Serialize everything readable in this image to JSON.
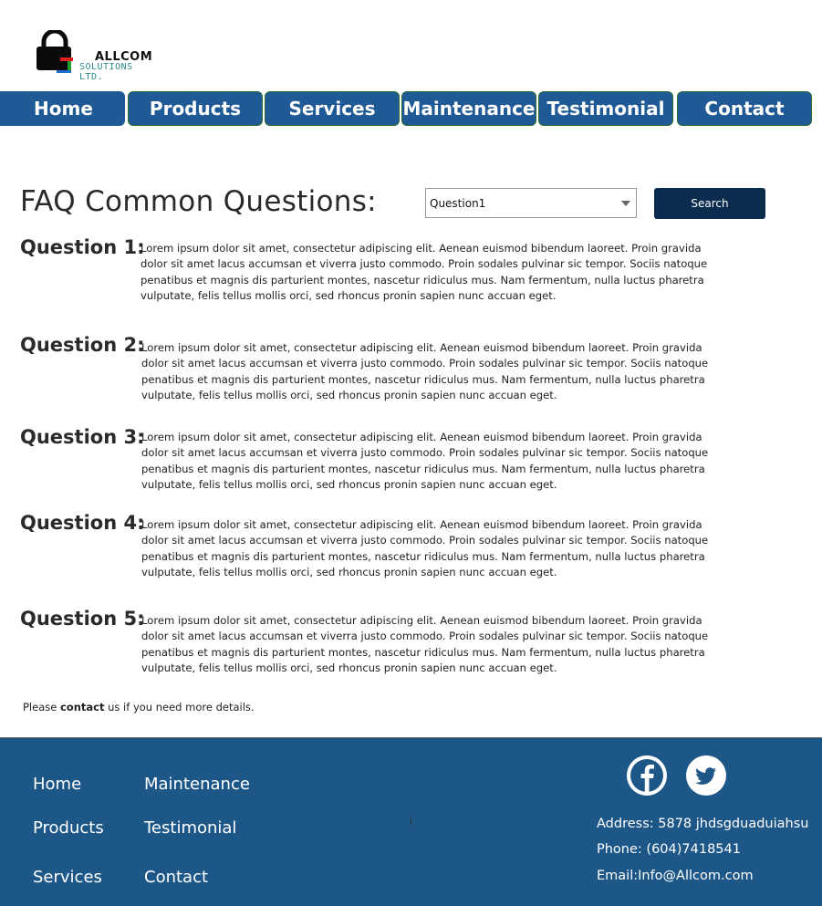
{
  "logo": {
    "line1": "ALLCOM",
    "line2": "SOLUTIONS LTD."
  },
  "nav": [
    "Home",
    "Products",
    "Services",
    "Maintenance",
    "Testimonial",
    "Contact"
  ],
  "faq": {
    "title": "FAQ Common Questions:",
    "select_value": "Question1",
    "search_label": "Search"
  },
  "questions": [
    {
      "label": "Question 1:",
      "text": "Lorem ipsum dolor sit amet, consectetur adipiscing elit. Aenean euismod bibendum laoreet. Proin gravida dolor sit amet lacus accumsan et viverra justo commodo. Proin sodales pulvinar sic tempor. Sociis natoque penatibus et magnis dis parturient montes, nascetur ridiculus mus. Nam fermentum, nulla luctus pharetra vulputate, felis tellus mollis orci, sed rhoncus pronin sapien nunc accuan eget."
    },
    {
      "label": "Question 2:",
      "text": "Lorem ipsum dolor sit amet, consectetur adipiscing elit. Aenean euismod bibendum laoreet. Proin gravida dolor sit amet lacus accumsan et viverra justo commodo. Proin sodales pulvinar sic tempor. Sociis natoque penatibus et magnis dis parturient montes, nascetur ridiculus mus. Nam fermentum, nulla luctus pharetra vulputate, felis tellus mollis orci, sed rhoncus pronin sapien nunc accuan eget."
    },
    {
      "label": "Question 3:",
      "text": "Lorem ipsum dolor sit amet, consectetur adipiscing elit. Aenean euismod bibendum laoreet. Proin gravida dolor sit amet lacus accumsan et viverra justo commodo. Proin sodales pulvinar sic tempor. Sociis natoque penatibus et magnis dis parturient montes, nascetur ridiculus mus. Nam fermentum, nulla luctus pharetra vulputate, felis tellus mollis orci, sed rhoncus pronin sapien nunc accuan eget."
    },
    {
      "label": "Question 4:",
      "text": "Lorem ipsum dolor sit amet, consectetur adipiscing elit. Aenean euismod bibendum laoreet. Proin gravida dolor sit amet lacus accumsan et viverra justo commodo. Proin sodales pulvinar sic tempor. Sociis natoque penatibus et magnis dis parturient montes, nascetur ridiculus mus. Nam fermentum, nulla luctus pharetra vulputate, felis tellus mollis orci, sed rhoncus pronin sapien nunc accuan eget."
    },
    {
      "label": "Question 5:",
      "text": "Lorem ipsum dolor sit amet, consectetur adipiscing elit. Aenean euismod bibendum laoreet. Proin gravida dolor sit amet lacus accumsan et viverra justo commodo. Proin sodales pulvinar sic tempor. Sociis natoque penatibus et magnis dis parturient montes, nascetur ridiculus mus. Nam fermentum, nulla luctus pharetra vulputate, felis tellus mollis orci, sed rhoncus pronin sapien nunc accuan eget."
    }
  ],
  "contact_note": {
    "before": "Please ",
    "link": "contact",
    "after": " us if you need more details."
  },
  "footer": {
    "links": [
      "Home",
      "Maintenance",
      "Products",
      "Testimonial",
      "Services",
      "Contact"
    ],
    "address": "Address: 5878 jhdsgduaduiahsu",
    "phone": "Phone: (604)7418541",
    "email": "Email:Info@Allcom.com",
    "social": [
      "facebook-icon",
      "twitter-icon"
    ]
  },
  "colors": {
    "nav": "#1f5a96",
    "footer": "#1d5788",
    "search": "#0b2b4f"
  }
}
